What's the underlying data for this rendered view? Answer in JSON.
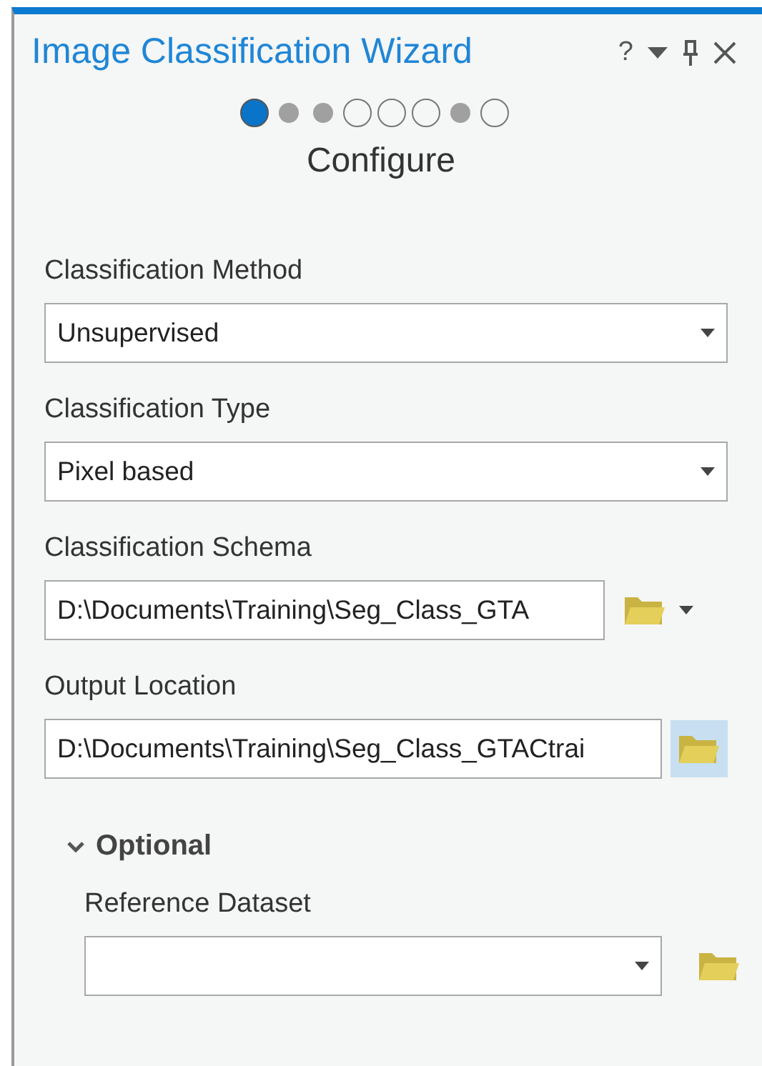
{
  "window": {
    "title": "Image Classification Wizard",
    "controls": [
      "?"
    ]
  },
  "steps": [
    {
      "selected": true
    },
    {
      "selected": false,
      "completed": true
    },
    {
      "selected": false,
      "completed": true
    },
    {
      "selected": false,
      "completed": false
    },
    {
      "selected": false,
      "completed": false
    },
    {
      "selected": false,
      "completed": false
    },
    {
      "selected": false,
      "completed": true
    },
    {
      "selected": false,
      "completed": false
    }
  ],
  "page_title": "Configure",
  "fields": [
    {
      "label": "Classification Method",
      "kind": "dropdown",
      "value": "Unsupervised"
    },
    {
      "label": "Classification Type",
      "kind": "dropdown",
      "value": "Pixel based"
    },
    {
      "label": "Classification Schema",
      "kind": "path-dropdown",
      "value": "D:\\Documents\\Training\\Seg_Class_GTA",
      "browse_highlighted": false
    },
    {
      "label": "Output Location",
      "kind": "path",
      "value": "D:\\Documents\\Training\\Seg_Class_GTACtrai",
      "browse_highlighted": true
    }
  ],
  "optional": {
    "label": "Optional",
    "expanded": true,
    "fields": [
      {
        "label": "Reference Dataset",
        "kind": "dropdown-browse",
        "browse_highlighted": false
      }
    ]
  }
}
